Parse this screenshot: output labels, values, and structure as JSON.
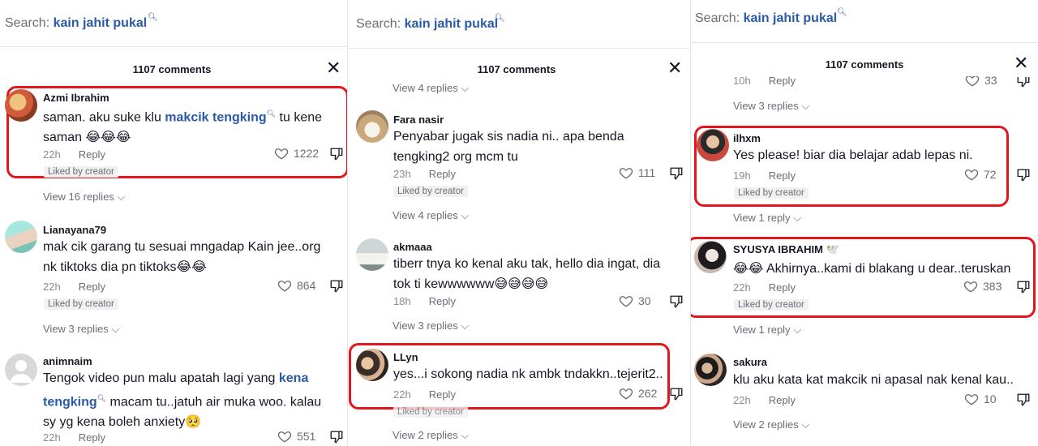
{
  "accent_color": "#e3161d",
  "link_color": "#2b5aa8",
  "panels": [
    {
      "search": {
        "label": "Search:",
        "query": "kain jahit pukal"
      },
      "comment_count": "1107 comments",
      "comments": [
        {
          "user": "Azmi Ibrahim",
          "line1_pre": "saman. aku suke klu ",
          "line1_kw": "makcik tengking",
          "line1_post": " tu kene",
          "line2": "saman 😂😂😂",
          "time": "22h",
          "reply": "Reply",
          "likes": "1222",
          "badge": "Liked by creator"
        },
        {
          "view_replies": "View 16 replies"
        },
        {
          "user": "Lianayana79",
          "line1": "mak cik garang tu sesuai mngadap Kain jee..org",
          "line2": "nk tiktoks dia pn tiktoks😂😂",
          "time": "22h",
          "reply": "Reply",
          "likes": "864",
          "badge": "Liked by creator"
        },
        {
          "view_replies": "View 3 replies"
        },
        {
          "user": "animnaim",
          "line1_pre": "Tengok video pun malu apatah lagi yang ",
          "line1_kw": "kena",
          "line2_kw": "tengking",
          "line2_post": " macam tu..jatuh air muka woo. kalau",
          "line3": "sy yg kena boleh anxiety🥺",
          "time": "22h",
          "reply": "Reply",
          "likes": "551"
        }
      ]
    },
    {
      "search": {
        "label": "Search:",
        "query": "kain jahit pukal"
      },
      "comment_count": "1107 comments",
      "comments": [
        {
          "view_replies": "View 4 replies"
        },
        {
          "user": "Fara nasir",
          "line1": "Penyabar jugak sis nadia ni.. apa benda",
          "line2": "tengking2 org mcm tu",
          "time": "23h",
          "reply": "Reply",
          "likes": "111",
          "badge": "Liked by creator"
        },
        {
          "view_replies": "View 4 replies"
        },
        {
          "user": "akmaaa",
          "line1": "tiberr tnya ko kenal aku tak, hello dia ingat, dia",
          "line2": "tok ti kewwwwww😅😅😅😅",
          "time": "18h",
          "reply": "Reply",
          "likes": "30"
        },
        {
          "view_replies": "View 3 replies"
        },
        {
          "user": "LLyn",
          "line1": "yes...i sokong nadia nk ambk tndakkn..tejerit2..",
          "time": "22h",
          "reply": "Reply",
          "likes": "262",
          "badge": "Liked by creator"
        },
        {
          "view_replies": "View 2 replies"
        }
      ]
    },
    {
      "search": {
        "label": "Search:",
        "query": "kain jahit pukal"
      },
      "comment_count": "1107 comments",
      "comments": [
        {
          "time": "10h",
          "reply": "Reply",
          "likes": "33"
        },
        {
          "view_replies": "View 3 replies"
        },
        {
          "user": "ilhxm",
          "line1": "Yes please! biar dia belajar adab lepas ni.",
          "time": "19h",
          "reply": "Reply",
          "likes": "72",
          "badge": "Liked by creator"
        },
        {
          "view_replies": "View 1 reply"
        },
        {
          "user": "SYUSYA IBRAHIM 🕊️",
          "line1": "😂😂 Akhirnya..kami di blakang u dear..teruskan",
          "time": "22h",
          "reply": "Reply",
          "likes": "383",
          "badge": "Liked by creator"
        },
        {
          "view_replies": "View 1 reply"
        },
        {
          "user": "sakura",
          "line1": "klu aku kata kat makcik ni apasal nak kenal kau..",
          "time": "22h",
          "reply": "Reply",
          "likes": "10"
        },
        {
          "view_replies": "View 2 replies"
        }
      ]
    }
  ]
}
